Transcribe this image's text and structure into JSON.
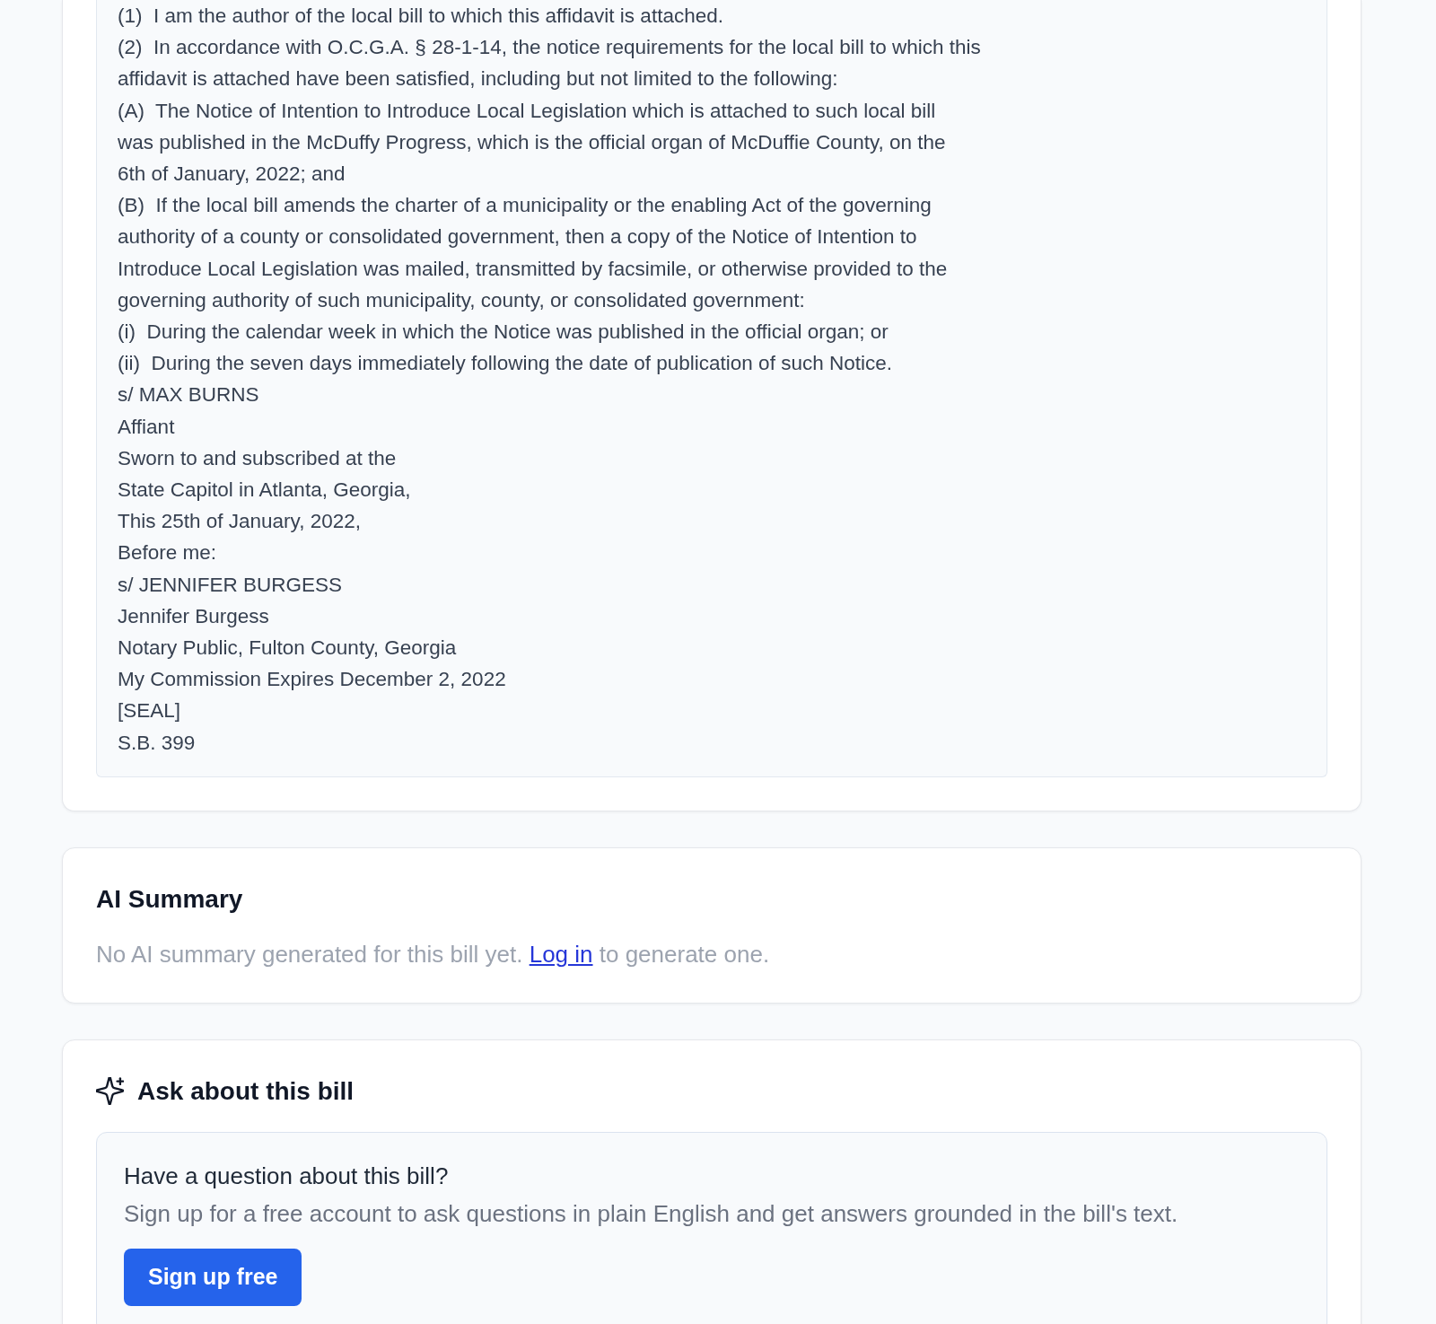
{
  "bill_text": {
    "paragraphs": [
      "(1)  I am the author of the local bill to which this affidavit is attached.",
      "(2)  In accordance with O.C.G.A. § 28-1-14, the notice requirements for the local bill to which this\naffidavit is attached have been satisfied, including but not limited to the following:",
      "(A)  The Notice of Intention to Introduce Local Legislation which is attached to such local bill\nwas published in the McDuffy Progress, which is the official organ of McDuffie County, on the\n6th of January, 2022; and",
      "(B)  If the local bill amends the charter of a municipality or the enabling Act of the governing\nauthority of a county or consolidated government, then a copy of the Notice of Intention to\nIntroduce Local Legislation was mailed, transmitted by facsimile, or otherwise provided to the\ngoverning authority of such municipality, county, or consolidated government:",
      "(i)  During the calendar week in which the Notice was published in the official organ; or",
      "(ii)  During the seven days immediately following the date of publication of such Notice.",
      "s/ MAX BURNS",
      "Affiant",
      "Sworn to and subscribed at the\nState Capitol in Atlanta, Georgia,\nThis 25th of January, 2022,\nBefore me:",
      "s/ JENNIFER BURGESS",
      "Jennifer Burgess",
      "Notary Public, Fulton County, Georgia",
      "My Commission Expires December 2, 2022",
      "[SEAL]",
      "S.B. 399"
    ]
  },
  "ai_summary": {
    "title": "AI Summary",
    "message": {
      "before": "No AI summary generated for this bill yet.",
      "link": "Log in",
      "after": "to generate one."
    }
  },
  "ask": {
    "title": "Ask about this bill",
    "prompt": {
      "heading": "Have a question about this bill?",
      "text": "Sign up for a free account to ask questions in plain English and get answers grounded in the bill's text.",
      "button": "Sign up free"
    }
  }
}
